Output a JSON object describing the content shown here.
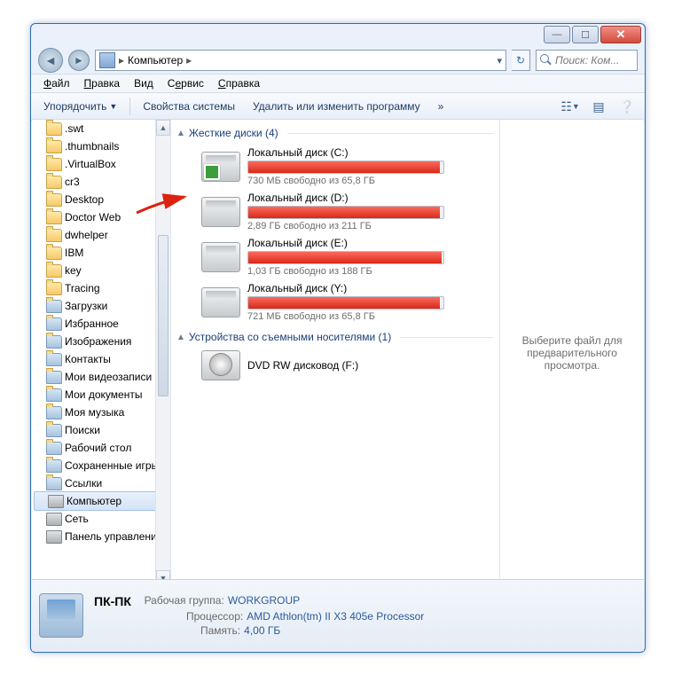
{
  "title_buttons": {
    "min": "—",
    "max": "☐",
    "close": "✕"
  },
  "breadcrumb": "Компьютер",
  "breadcrumb_sep": "▸",
  "refresh": "↻",
  "search_placeholder": "Поиск: Ком...",
  "menu": {
    "file": "Файл",
    "edit": "Правка",
    "view": "Вид",
    "tools": "Сервис",
    "help": "Справка"
  },
  "toolbar": {
    "organize": "Упорядочить",
    "props": "Свойства системы",
    "remove": "Удалить или изменить программу",
    "more": "»"
  },
  "tree": [
    {
      "label": ".swt"
    },
    {
      "label": ".thumbnails"
    },
    {
      "label": ".VirtualBox"
    },
    {
      "label": "cr3"
    },
    {
      "label": "Desktop"
    },
    {
      "label": "Doctor Web"
    },
    {
      "label": "dwhelper"
    },
    {
      "label": "IBM"
    },
    {
      "label": "key"
    },
    {
      "label": "Tracing"
    },
    {
      "label": "Загрузки",
      "special": true
    },
    {
      "label": "Избранное",
      "special": true
    },
    {
      "label": "Изображения",
      "special": true
    },
    {
      "label": "Контакты",
      "special": true
    },
    {
      "label": "Мои видеозаписи",
      "special": true
    },
    {
      "label": "Мои документы",
      "special": true
    },
    {
      "label": "Моя музыка",
      "special": true
    },
    {
      "label": "Поиски",
      "special": true
    },
    {
      "label": "Рабочий стол",
      "special": true
    },
    {
      "label": "Сохраненные игры",
      "special": true
    },
    {
      "label": "Ссылки",
      "special": true
    },
    {
      "label": "Компьютер",
      "computer": true,
      "selected": true
    },
    {
      "label": "Сеть",
      "computer": true
    },
    {
      "label": "Панель управления",
      "computer": true
    }
  ],
  "groups": {
    "hdd": "Жесткие диски (4)",
    "removable": "Устройства со съемными носителями (1)"
  },
  "drives": [
    {
      "name": "Локальный диск (C:)",
      "sub": "730 МБ свободно из 65,8 ГБ",
      "fill": 98,
      "os": true
    },
    {
      "name": "Локальный диск (D:)",
      "sub": "2,89 ГБ свободно из 211 ГБ",
      "fill": 98
    },
    {
      "name": "Локальный диск (E:)",
      "sub": "1,03 ГБ свободно из 188 ГБ",
      "fill": 99
    },
    {
      "name": "Локальный диск (Y:)",
      "sub": "721 МБ свободно из 65,8 ГБ",
      "fill": 98
    }
  ],
  "dvd": "DVD RW дисковод (F:)",
  "preview": "Выберите файл для предварительного просмотра.",
  "status": {
    "name": "ПК-ПК",
    "wg_label": "Рабочая группа:",
    "wg": "WORKGROUP",
    "cpu_label": "Процессор:",
    "cpu": "AMD Athlon(tm) II X3 405e Processor",
    "mem_label": "Память:",
    "mem": "4,00 ГБ"
  }
}
